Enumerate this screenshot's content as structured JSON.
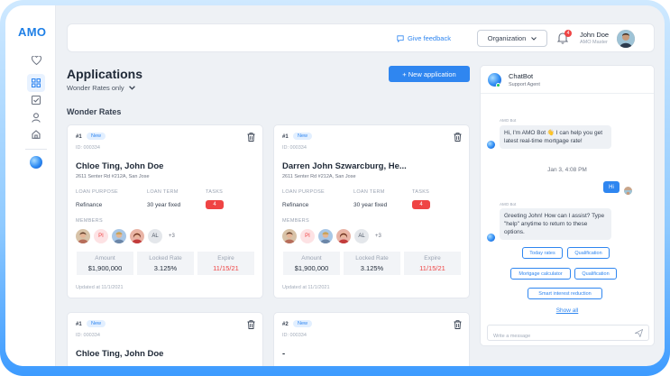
{
  "app": {
    "logo": "AMO"
  },
  "topbar": {
    "feedback": "Give feedback",
    "organization": "Organization",
    "notifications_count": "4",
    "user_name": "John Doe",
    "user_role": "AMO Master"
  },
  "header": {
    "title": "Applications",
    "filter": "Wonder Rates only",
    "new_application": "+ New application",
    "section_title": "Wonder Rates"
  },
  "labels": {
    "loan_purpose": "LOAN PURPOSE",
    "loan_term": "LOAN TERM",
    "tasks": "TASKS",
    "members": "MEMBERS",
    "amount": "Amount",
    "locked_rate": "Locked Rate",
    "expire": "Expire"
  },
  "cards": [
    {
      "num": "#1",
      "badge": "New",
      "id": "ID: 000334",
      "name": "Chloe Ting, John Doe",
      "address": "2611 Senter Rd #212A, San Jose",
      "loan_purpose": "Refinance",
      "loan_term": "30 year fixed",
      "tasks": "4",
      "members": [
        "",
        "PI",
        "",
        "",
        "AL"
      ],
      "members_more": "+3",
      "amount": "$1,900,000",
      "locked_rate": "3.125%",
      "expire": "11/15/21",
      "updated": "Updated at 11/1/2021"
    },
    {
      "num": "#1",
      "badge": "New",
      "id": "ID: 000334",
      "name": "Darren John Szwarcburg, He...",
      "address": "2611 Senter Rd #212A, San Jose",
      "loan_purpose": "Refinance",
      "loan_term": "30 year fixed",
      "tasks": "4",
      "members": [
        "",
        "PI",
        "",
        "",
        "AL"
      ],
      "members_more": "+3",
      "amount": "$1,900,000",
      "locked_rate": "3.125%",
      "expire": "11/15/21",
      "updated": "Updated at 11/1/2021"
    },
    {
      "num": "#1",
      "badge": "New",
      "id": "ID: 000334",
      "name": "Chloe Ting, John Doe"
    },
    {
      "num": "#2",
      "badge": "New",
      "id": "ID: 000334",
      "name": "-"
    }
  ],
  "chat": {
    "title": "ChatBot",
    "subtitle": "Support Agent",
    "bot_label": "AMO Bot",
    "msg1": "Hi, I'm AMO Bot 👋 I can help you get latest real-time mortgage rate!",
    "date": "Jan 3, 4:08 PM",
    "user_msg": "Hi",
    "msg2": "Greeting John! How can I assist? Type \"help\" anytime to return to these options.",
    "chips": [
      "Today rates",
      "Qualification",
      "Mortgage calculator",
      "Qualification",
      "Smart interest reduction"
    ],
    "show_all": "Show all",
    "input_placeholder": "Write a message"
  },
  "colors": {
    "accent": "#2f86f0",
    "danger": "#ef4444",
    "badge_bg": "#e2efff"
  }
}
